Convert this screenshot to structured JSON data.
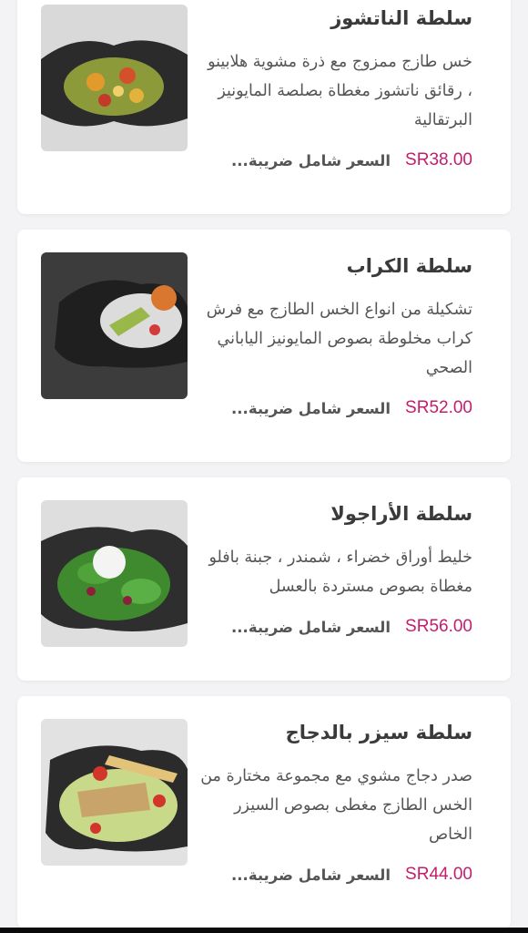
{
  "menu": {
    "items": [
      {
        "title": "سلطة الناتشوز",
        "description": "خس طازج ممزوج مع ذرة مشوية هلابينو ، رقائق ناتشوز مغطاة بصلصة المايونيز البرتقالية",
        "price": "SR38.00",
        "tax_note": "السعر شامل ضريبة...",
        "image_icon": "nachos-salad-photo"
      },
      {
        "title": "سلطة الكراب",
        "description": "تشكيلة من انواع الخس الطازج مع فرش كراب مخلوطة بصوص المايونيز الياباني الصحي",
        "price": "SR52.00",
        "tax_note": "السعر شامل ضريبة...",
        "image_icon": "crab-salad-photo"
      },
      {
        "title": "سلطة الأراجولا",
        "description": "خليط أوراق خضراء ، شمندر ، جبنة بافلو مغطاة بصوص مستردة بالعسل",
        "price": "SR56.00",
        "tax_note": "السعر شامل ضريبة...",
        "image_icon": "arugula-salad-photo"
      },
      {
        "title": "سلطة سيزر بالدجاج",
        "description": "صدر دجاج مشوي مع مجموعة مختارة من الخس الطازج مغطى بصوص السيزر الخاص",
        "price": "SR44.00",
        "tax_note": "السعر شامل ضريبة...",
        "image_icon": "chicken-caesar-salad-photo"
      }
    ]
  },
  "colors": {
    "price": "#c41d6b",
    "background": "#f3f3f5",
    "card": "#ffffff"
  }
}
